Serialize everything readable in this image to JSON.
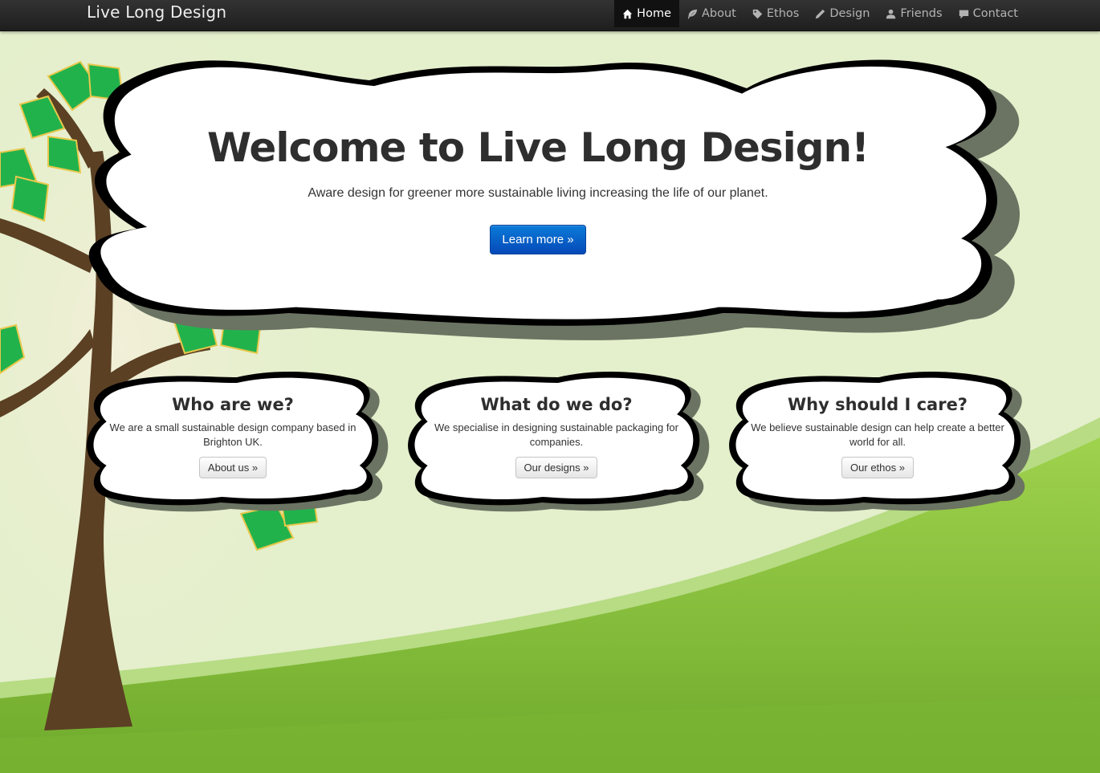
{
  "navbar": {
    "brand": "Live Long Design",
    "items": [
      {
        "label": "Home",
        "icon": "home-icon",
        "active": true
      },
      {
        "label": "About",
        "icon": "leaf-icon",
        "active": false
      },
      {
        "label": "Ethos",
        "icon": "tag-icon",
        "active": false
      },
      {
        "label": "Design",
        "icon": "pencil-icon",
        "active": false
      },
      {
        "label": "Friends",
        "icon": "user-icon",
        "active": false
      },
      {
        "label": "Contact",
        "icon": "comment-icon",
        "active": false
      }
    ]
  },
  "hero": {
    "title": "Welcome to Live Long Design!",
    "subtitle": "Aware design for greener more sustainable living increasing the life of our planet.",
    "button": "Learn more »"
  },
  "cards": [
    {
      "title": "Who are we?",
      "text": "We are a small sustainable design company based in Brighton UK.",
      "button": "About us »"
    },
    {
      "title": "What do we do?",
      "text": "We specialise in designing sustainable packaging for companies.",
      "button": "Our designs »"
    },
    {
      "title": "Why should I care?",
      "text": "We believe sustainable design can help create a better world for all.",
      "button": "Our ethos »"
    }
  ],
  "colors": {
    "background": "#e4efcc",
    "grass": "#8cc63f",
    "leaves": "#22b24c",
    "trunk": "#5b3f22",
    "primary_button": "#0a6fd2"
  }
}
